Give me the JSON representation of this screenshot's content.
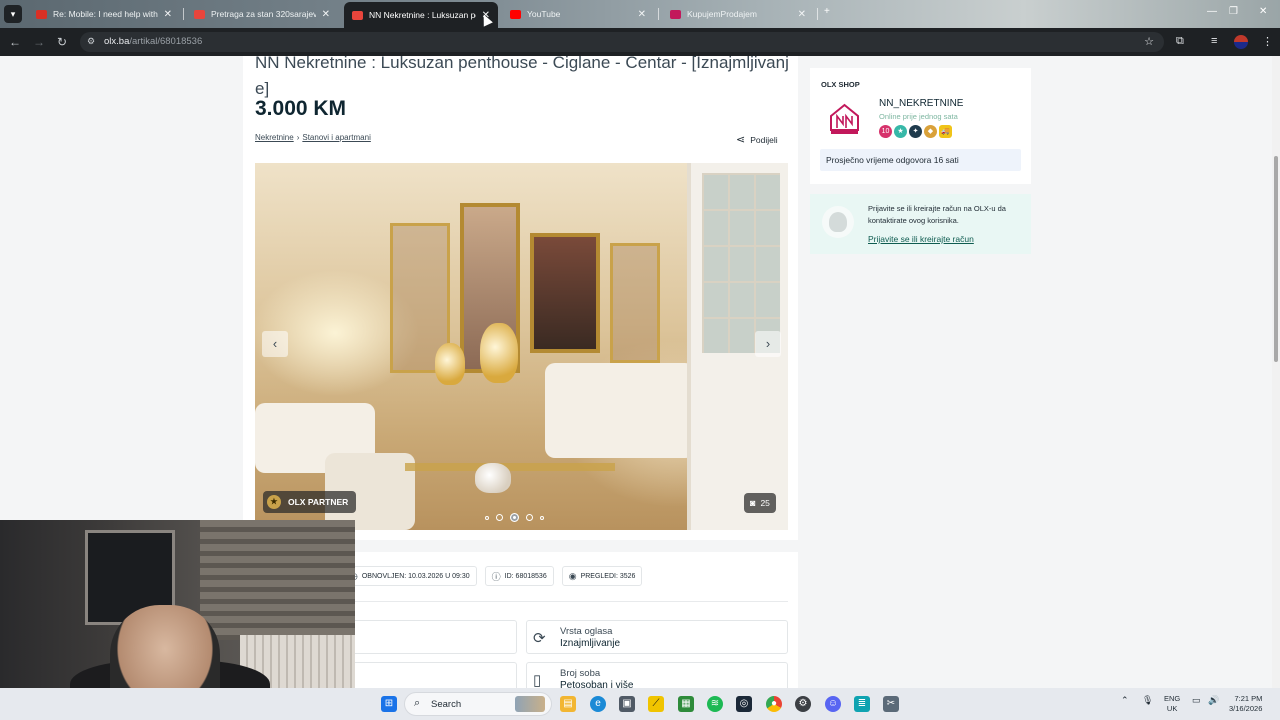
{
  "browser": {
    "tabs": [
      {
        "title": "Re: Mobile: I need help with [se",
        "favicon_color": "#d93025"
      },
      {
        "title": "Pretraga za stan 320sarajevo",
        "favicon_color": "#e8453c"
      },
      {
        "title": "NN Nekretnine : Luksuzan pent",
        "favicon_color": "#e8453c"
      },
      {
        "title": "YouTube",
        "favicon_color": "#ff0000"
      },
      {
        "title": "KupujemProdajem",
        "favicon_color": "#c2185b"
      }
    ],
    "active_tab_index": 2,
    "tab_menu_icon": "chevron-down-icon",
    "url_domain": "olx.ba",
    "url_path": "/artikal/68018536"
  },
  "listing": {
    "title": "NN Nekretnine : Luksuzan penthouse - Ciglane - Centar - [Iznajmljivanj e]",
    "price": "3.000 KM",
    "breadcrumb": [
      "Nekretnine",
      "Stanovi i apartmani"
    ],
    "share_label": "Podijeli",
    "partner_label": "OLX PARTNER",
    "photo_count": "25",
    "dots_total": 5,
    "dots_active_index": 2,
    "meta": {
      "renewed": "OBNOVLJEN: 10.03.2026 U 09:30",
      "id": "ID: 68018536",
      "views": "PREGLEDI: 3526"
    },
    "attributes": [
      {
        "key": "Vrsta oglasa",
        "value": "Iznajmljivanje",
        "icon": "refresh-icon"
      },
      {
        "key": "Broj soba",
        "value": "Petosoban i više",
        "icon": "door-icon"
      }
    ]
  },
  "seller": {
    "shop_label": "OLX SHOP",
    "name": "NN_NEKRETNINE",
    "status": "Online prije jednog sata",
    "response_time": "Prosječno vrijeme odgovora 16 sati",
    "badges": [
      "10",
      "★",
      "✦",
      "◆",
      "🚚"
    ]
  },
  "login": {
    "text": "Prijavite se ili kreirajte račun na OLX-u da kontaktirate ovog korisnika.",
    "link": "Prijavite se ili kreirajte račun"
  },
  "taskbar": {
    "search_label": "Search",
    "language": "ENG",
    "language_region": "UK",
    "time": "7:21 PM",
    "date": "3/16/2026"
  },
  "colors": {
    "accent": "#0f2631",
    "link": "#0f5c50",
    "login_bg": "#e9f7f4"
  }
}
